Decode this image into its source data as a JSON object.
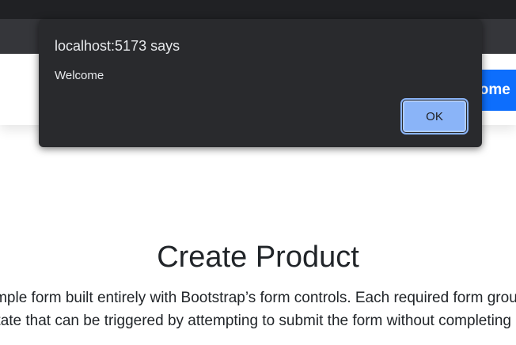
{
  "dialog": {
    "title": "localhost:5173 says",
    "message": "Welcome",
    "ok_label": "OK"
  },
  "navbar": {
    "button_label": "Home"
  },
  "main": {
    "heading": "Create Product",
    "lead_lines": [
      "Below is an example form built entirely with Bootstrap’s form controls. Each required form group has a validation",
      "state that can be triggered by attempting to submit the form without completing it."
    ]
  },
  "colors": {
    "primary": "#0d6efd",
    "dialog_bg": "#292a2d",
    "dialog_button": "#8ab4f8"
  }
}
